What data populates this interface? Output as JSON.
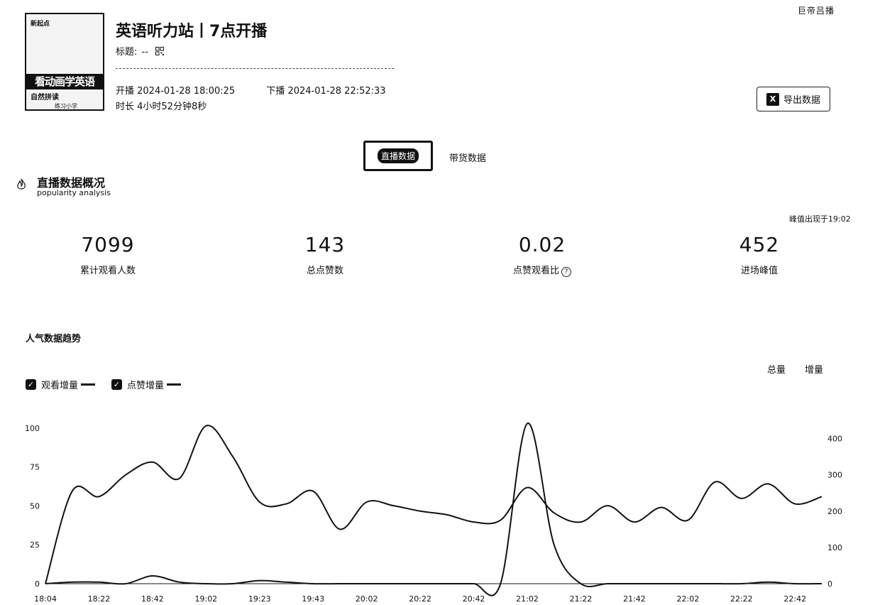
{
  "brand": "巨帝吕播",
  "cover": {
    "tag": "新起点",
    "band": "看动画学英语",
    "sub": "自然拼读",
    "foot": "练习小学"
  },
  "room": {
    "title": "英语听力站丨7点开播",
    "label_title_prefix": "标题:",
    "label_title_value": "--",
    "start": "开播 2024-01-28 18:00:25",
    "end": "下播 2024-01-28 22:52:33",
    "duration": "时长 4小时52分钟8秒"
  },
  "export_label": "导出数据",
  "tabs": {
    "live": "直播数据",
    "goods": "带货数据"
  },
  "overview": {
    "title": "直播数据概况",
    "subtitle": "popularity analysis",
    "peak_note": "峰值出现于19:02"
  },
  "stats": [
    {
      "value": "7099",
      "label": "累计观看人数"
    },
    {
      "value": "143",
      "label": "总点赞数"
    },
    {
      "value": "0.02",
      "label": "点赞观看比"
    },
    {
      "value": "452",
      "label": "进场峰值"
    }
  ],
  "trend": {
    "title": "人气数据趋势",
    "toggle_total": "总量",
    "toggle_increment": "增量",
    "legend_views": "观看增量",
    "legend_likes": "点赞增量"
  },
  "chart_data": {
    "type": "line",
    "x": [
      "18:04",
      "18:12",
      "18:22",
      "18:32",
      "18:42",
      "18:52",
      "19:02",
      "19:12",
      "19:23",
      "19:33",
      "19:43",
      "19:52",
      "20:02",
      "20:12",
      "20:22",
      "20:32",
      "20:42",
      "20:52",
      "21:02",
      "21:12",
      "21:22",
      "21:32",
      "21:42",
      "21:52",
      "22:02",
      "22:12",
      "22:22",
      "22:32",
      "22:42",
      "22:50"
    ],
    "x_tick_labels": [
      "18:04",
      "18:22",
      "18:42",
      "19:02",
      "19:23",
      "19:43",
      "20:02",
      "20:22",
      "20:42",
      "21:02",
      "21:22",
      "21:42",
      "22:02",
      "22:22",
      "22:42"
    ],
    "y_left": {
      "ticks": [
        0,
        25,
        50,
        75,
        100
      ],
      "lim": [
        0,
        105
      ]
    },
    "y_right": {
      "ticks": [
        0,
        100,
        200,
        300,
        400
      ],
      "lim": [
        0,
        450
      ]
    },
    "series": [
      {
        "name": "观看增量",
        "axis": "right",
        "values": [
          0,
          255,
          240,
          300,
          335,
          290,
          435,
          350,
          225,
          220,
          255,
          150,
          225,
          215,
          200,
          190,
          170,
          175,
          265,
          195,
          170,
          215,
          170,
          210,
          175,
          280,
          235,
          275,
          220,
          240
        ]
      },
      {
        "name": "点赞增量",
        "axis": "left",
        "values": [
          0,
          1,
          1,
          0,
          5,
          1,
          0,
          0,
          2,
          1,
          0,
          0,
          0,
          0,
          0,
          0,
          0,
          0,
          103,
          25,
          0,
          0,
          0,
          0,
          0,
          0,
          0,
          1,
          0,
          0
        ]
      }
    ]
  }
}
